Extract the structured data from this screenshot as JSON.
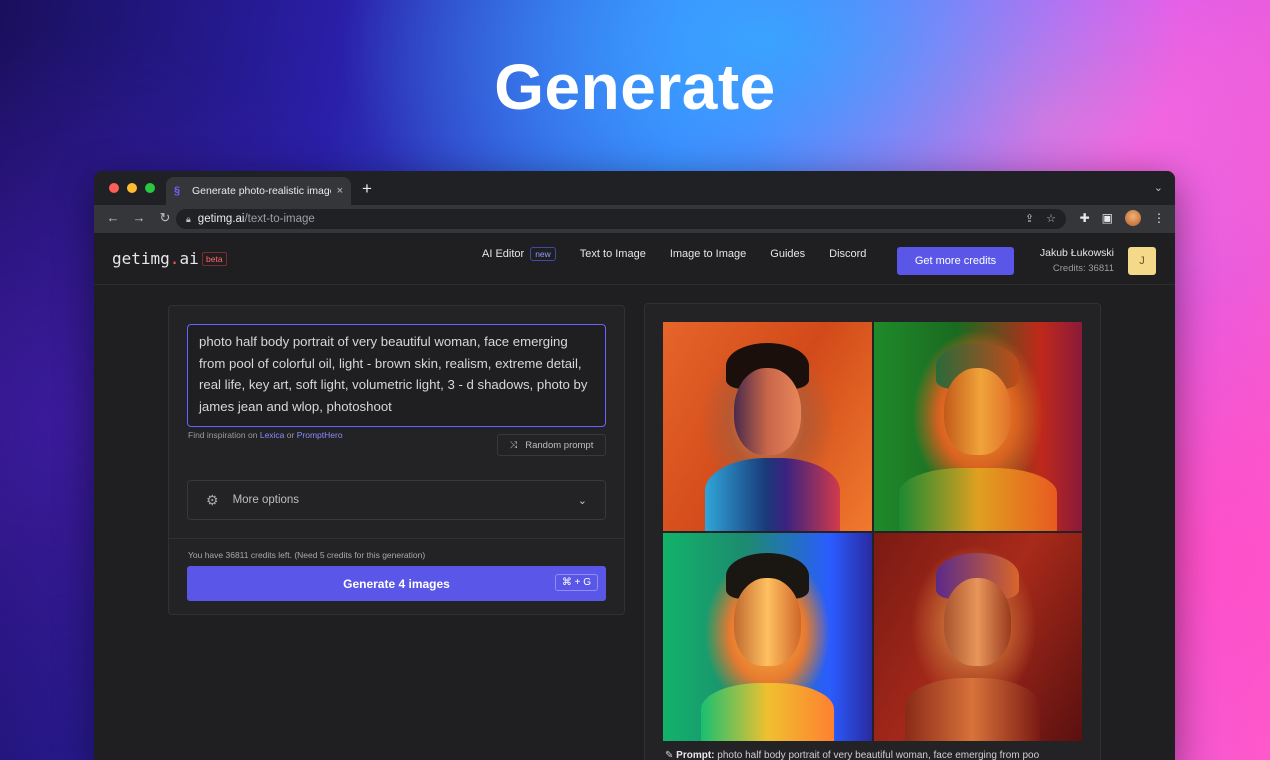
{
  "hero": {
    "title": "Generate"
  },
  "browser": {
    "tab_title": "Generate photo-realistic image",
    "tab_close": "×",
    "new_tab": "+",
    "url_host": "getimg.ai",
    "url_path": "/text-to-image"
  },
  "header": {
    "logo_prefix": "getimg",
    "logo_dot": ".",
    "logo_suffix": "ai",
    "beta": "beta",
    "nav": [
      {
        "label": "AI Editor",
        "badge": "new"
      },
      {
        "label": "Text to Image"
      },
      {
        "label": "Image to Image"
      },
      {
        "label": "Guides"
      },
      {
        "label": "Discord"
      }
    ],
    "cta": "Get more credits",
    "user_name": "Jakub Łukowski",
    "user_credits": "Credits: 36811",
    "avatar_initial": "J"
  },
  "form": {
    "prompt": "photo half body portrait of very beautiful woman, face emerging from pool of colorful oil, light - brown skin, realism, extreme detail, real life, key art, soft light, volumetric light, 3 - d shadows, photo by james jean and wlop, photoshoot",
    "inspire_prefix": "Find inspiration on",
    "inspire_link1": "Lexica",
    "inspire_or": "or",
    "inspire_link2": "PromptHero",
    "random_prompt": "Random prompt",
    "more_options": "More options",
    "credits_note": "You have 36811 credits left. (Need 5 credits for this generation)",
    "generate": "Generate 4 images",
    "shortcut": "⌘ + G"
  },
  "results": {
    "caption_label": "Prompt:",
    "caption_text": "photo half body portrait of very beautiful woman, face emerging from poo"
  },
  "icons": {
    "back": "arrow-left-icon",
    "forward": "arrow-right-icon",
    "reload": "reload-icon",
    "lock": "lock-icon",
    "share": "share-icon",
    "bookmark": "star-icon",
    "extensions": "puzzle-icon",
    "sidebar": "sidebar-icon",
    "menu": "kebab-menu-icon",
    "settings": "gear-icon",
    "shuffle": "shuffle-icon",
    "chevron": "chevron-down-icon"
  },
  "colors": {
    "accent": "#5a57e8",
    "beta": "#ff6b6b",
    "new_badge": "#8c9cff"
  }
}
